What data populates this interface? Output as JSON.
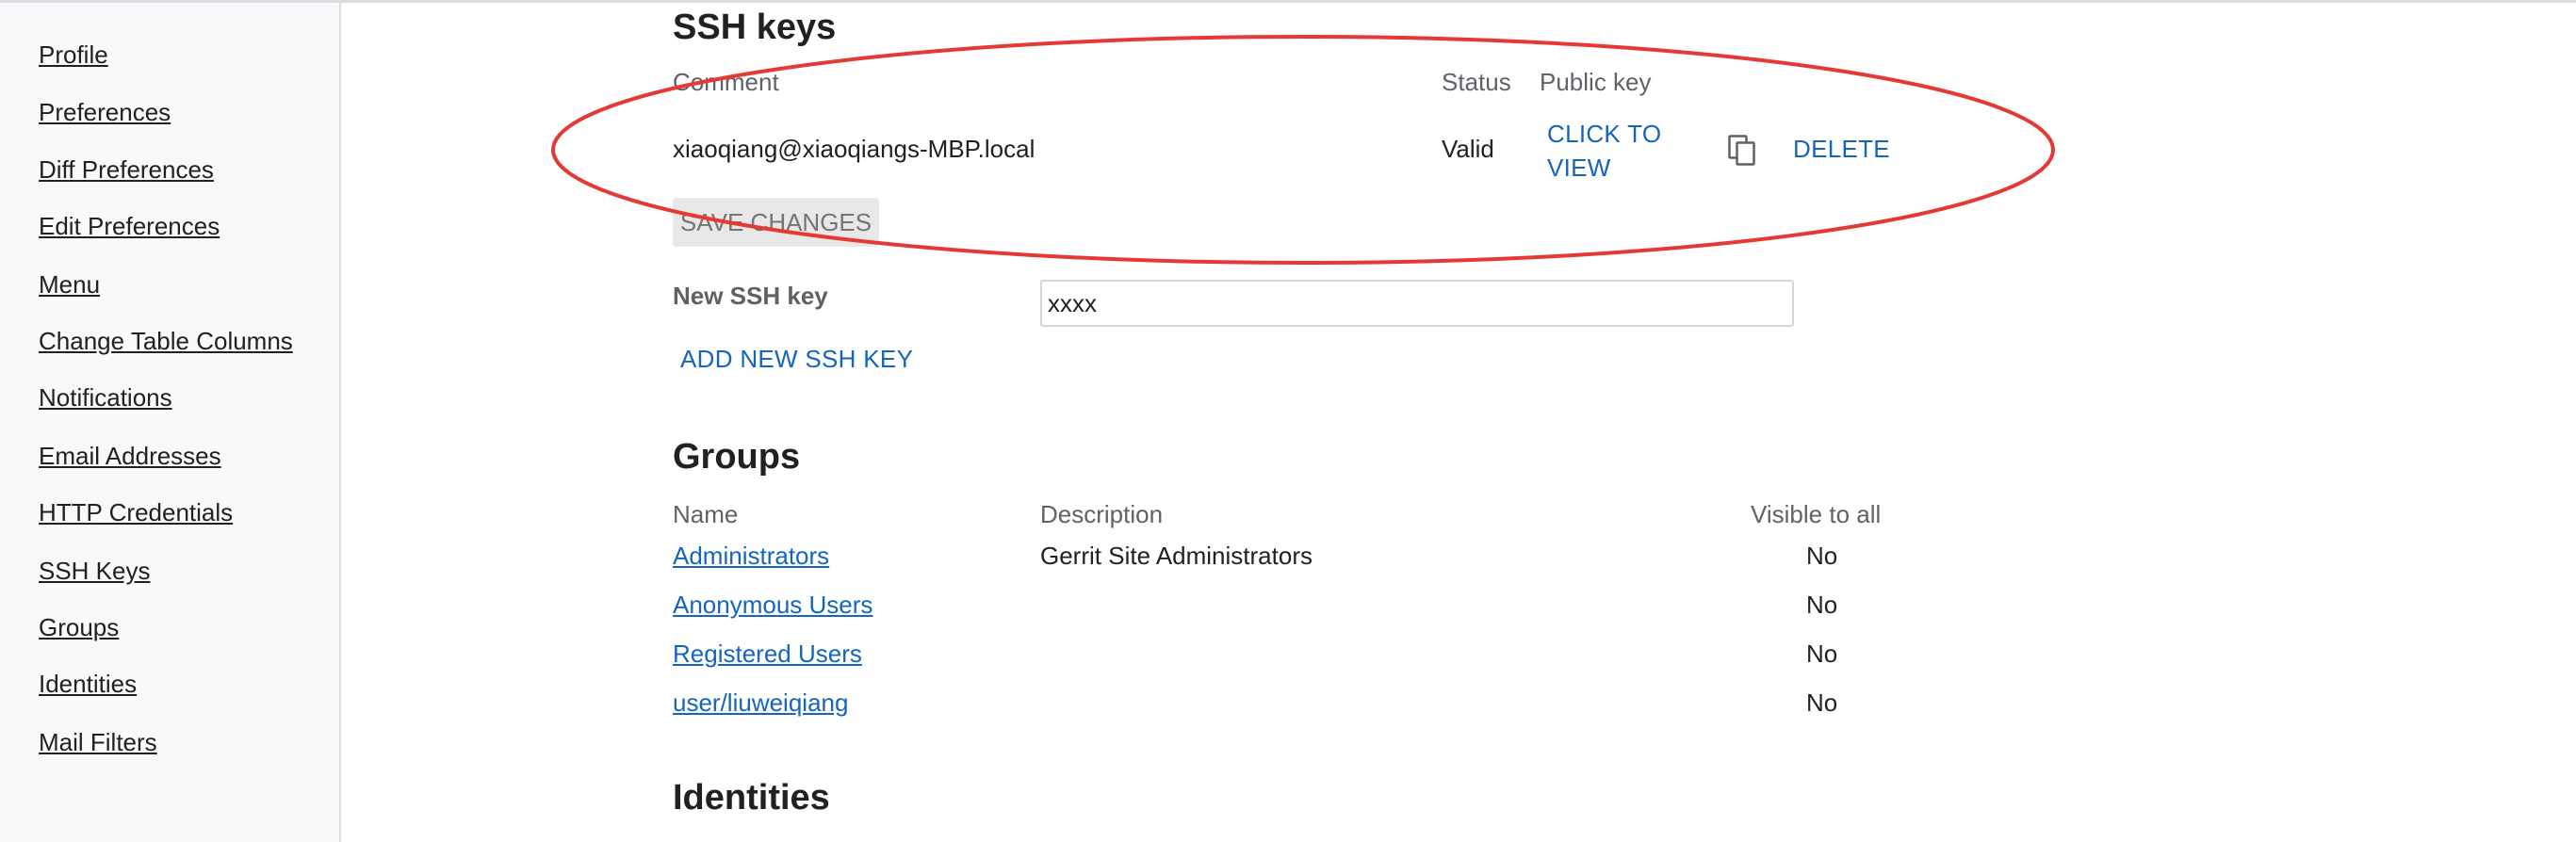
{
  "sidebar": {
    "items": [
      {
        "label": "Profile"
      },
      {
        "label": "Preferences"
      },
      {
        "label": "Diff Preferences"
      },
      {
        "label": "Edit Preferences"
      },
      {
        "label": "Menu"
      },
      {
        "label": "Change Table Columns"
      },
      {
        "label": "Notifications"
      },
      {
        "label": "Email Addresses"
      },
      {
        "label": "HTTP Credentials"
      },
      {
        "label": "SSH Keys"
      },
      {
        "label": "Groups"
      },
      {
        "label": "Identities"
      },
      {
        "label": "Mail Filters"
      }
    ]
  },
  "ssh_keys": {
    "title": "SSH keys",
    "headers": {
      "comment": "Comment",
      "status": "Status",
      "public_key": "Public key"
    },
    "rows": [
      {
        "comment": "xiaoqiang@xiaoqiangs-MBP.local",
        "status": "Valid",
        "view_line1": "CLICK TO",
        "view_line2": "VIEW",
        "copy_icon": "copy-icon",
        "delete_label": "DELETE"
      }
    ],
    "save_label": "SAVE CHANGES",
    "new_key_label": "New SSH key",
    "new_key_value": "xxxx",
    "add_label": "ADD NEW SSH KEY"
  },
  "groups": {
    "title": "Groups",
    "headers": {
      "name": "Name",
      "description": "Description",
      "visible": "Visible to all"
    },
    "rows": [
      {
        "name": "Administrators",
        "description": "Gerrit Site Administrators",
        "visible": "No"
      },
      {
        "name": "Anonymous Users",
        "description": "",
        "visible": "No"
      },
      {
        "name": "Registered Users",
        "description": "",
        "visible": "No"
      },
      {
        "name": "user/liuweiqiang",
        "description": "",
        "visible": "No"
      }
    ]
  },
  "identities": {
    "title": "Identities"
  },
  "colors": {
    "link": "#1565c0",
    "annotation": "#e53935",
    "sidebar_bg": "#f8f9fa"
  }
}
